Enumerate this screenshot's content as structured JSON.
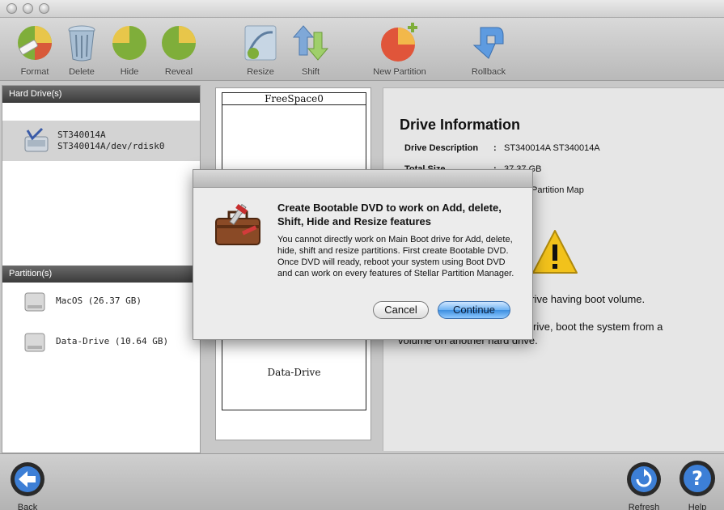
{
  "toolbar": {
    "format": "Format",
    "delete": "Delete",
    "hide": "Hide",
    "reveal": "Reveal",
    "resize": "Resize",
    "shift": "Shift",
    "new_partition": "New Partition",
    "rollback": "Rollback"
  },
  "hard_drives": {
    "header": "Hard Drive(s)",
    "items": [
      {
        "name": "ST340014A",
        "path": "ST340014A/dev/rdisk0",
        "icon": "hard-drive-icon"
      }
    ]
  },
  "partitions": {
    "header": "Partition(s)",
    "items": [
      {
        "label": "MacOS (26.37 GB)",
        "icon": "disk-icon"
      },
      {
        "label": "Data-Drive (10.64 GB)",
        "icon": "disk-icon"
      }
    ]
  },
  "partition_map": {
    "top_label": "FreeSpace0",
    "bottom_label": "Data-Drive"
  },
  "drive_info": {
    "title": "Drive Information",
    "rows": [
      {
        "key": "Drive Description",
        "colon": ":",
        "value": "ST340014A ST340014A"
      },
      {
        "key": "Total Size",
        "colon": ":",
        "value": "37.37 GB"
      },
      {
        "key": "",
        "colon": "",
        "value": "Partition Map"
      }
    ],
    "warning_icon": "warning-icon",
    "warning_line1": "drive having boot volume.",
    "warning_line2": "rive, boot the system from a",
    "warning_line3": "volume on another hard drive."
  },
  "dialog": {
    "icon": "toolbox-icon",
    "title": "Create Bootable DVD to work on Add, delete, Shift, Hide and Resize features",
    "message": "You cannot directly work on Main Boot drive for Add, delete, hide, shift and resize partitions. First create Bootable DVD. Once DVD will ready, reboot your system using Boot DVD and can work on every features of Stellar Partition Manager.",
    "cancel": "Cancel",
    "continue": "Continue"
  },
  "bottom": {
    "back": "Back",
    "refresh": "Refresh",
    "help": "Help"
  },
  "colors": {
    "panel_header": "#4a4a4a",
    "continue_button": "#5aa6ee",
    "warning": "#f2c21b"
  }
}
